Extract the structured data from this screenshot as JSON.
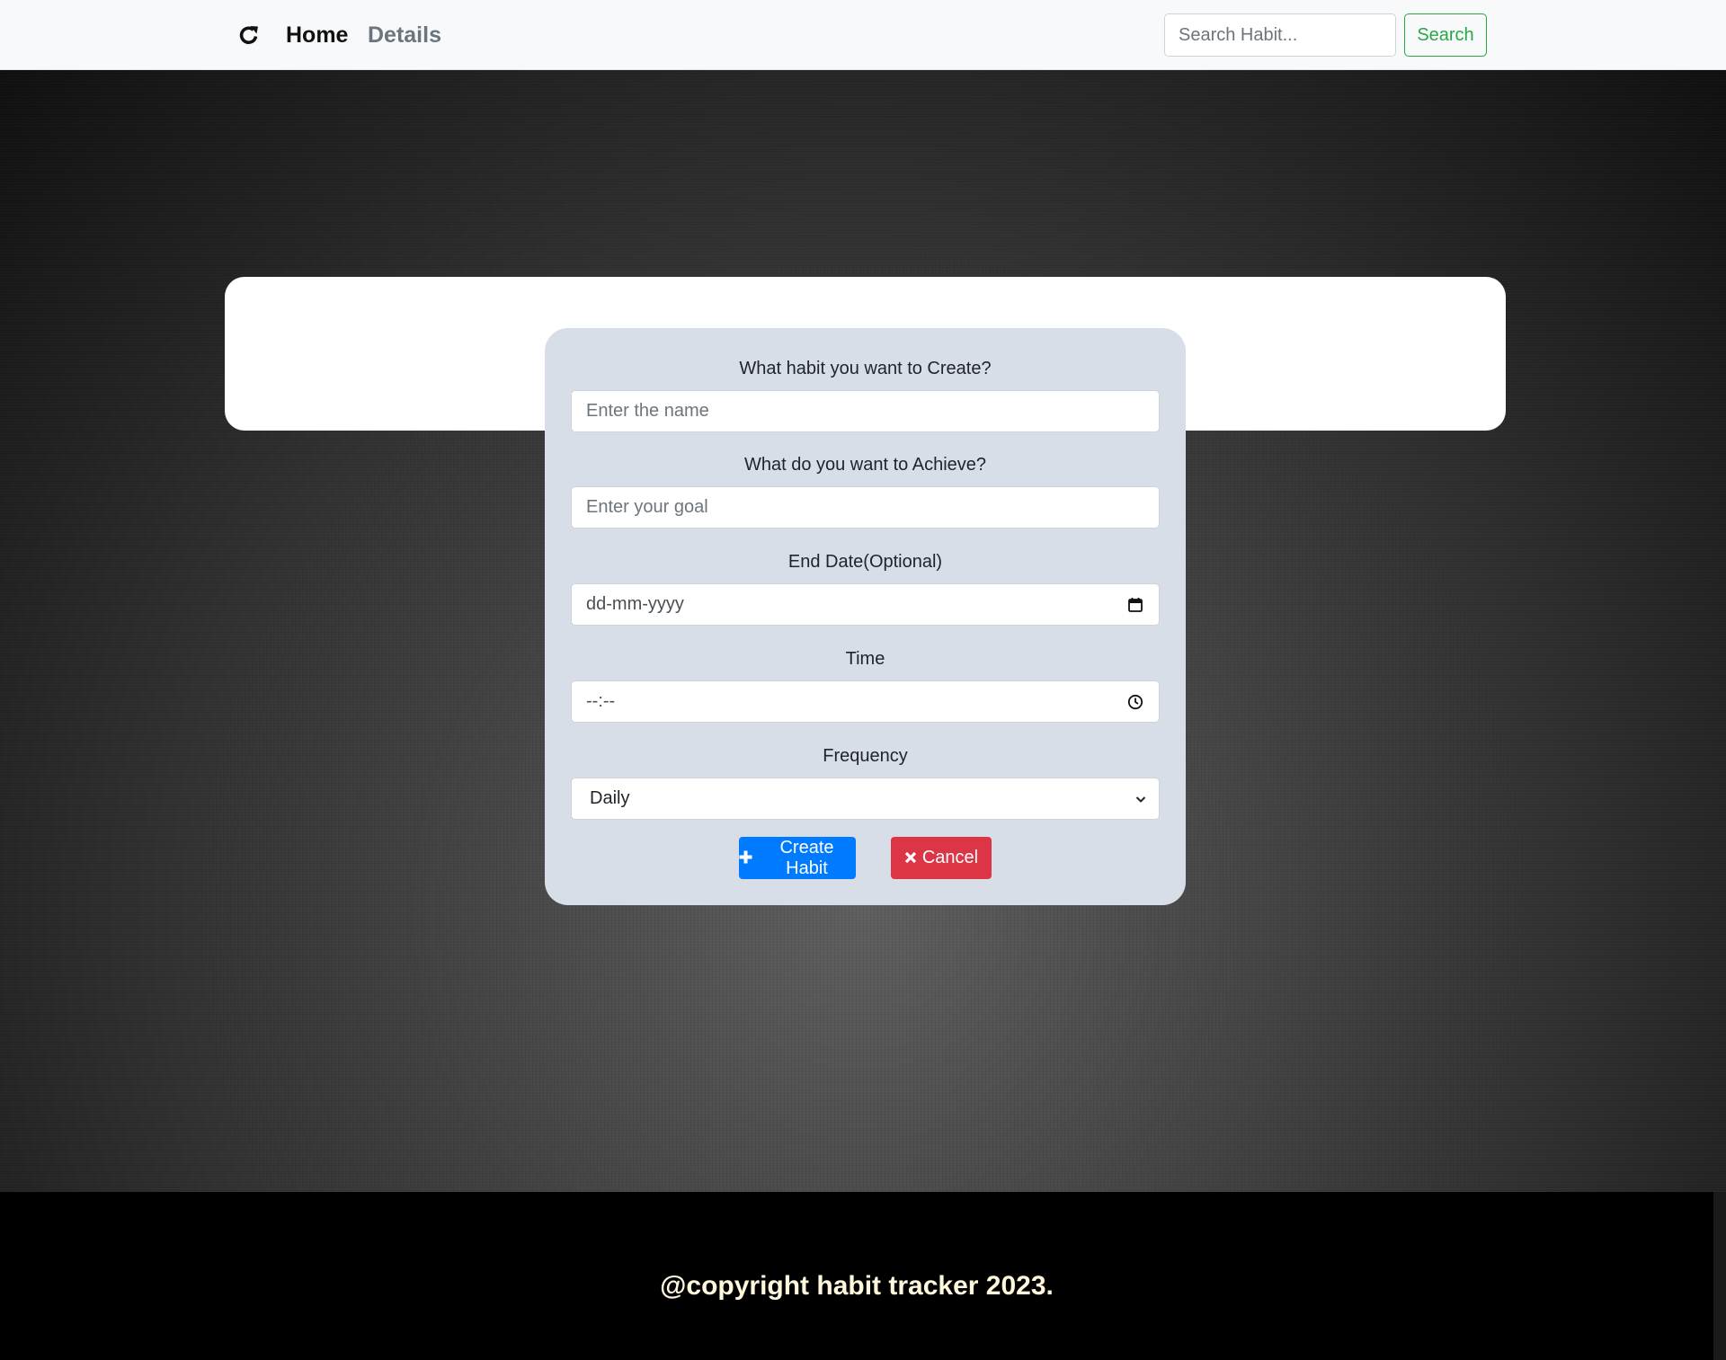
{
  "navbar": {
    "brand_icon": "refresh-icon",
    "home_label": "Home",
    "details_label": "Details",
    "search_placeholder": "Search Habit...",
    "search_button_label": "Search",
    "accent_color": "#28a745"
  },
  "form": {
    "habit_name": {
      "label": "What habit you want to Create?",
      "placeholder": "Enter the name"
    },
    "goal": {
      "label": "What do you want to Achieve?",
      "placeholder": "Enter your goal"
    },
    "end_date": {
      "label": "End Date(Optional)",
      "placeholder": "dd-mm-yyyy",
      "icon": "calendar-icon"
    },
    "time": {
      "label": "Time",
      "placeholder": "--:--",
      "icon": "clock-icon"
    },
    "frequency": {
      "label": "Frequency",
      "selected": "Daily",
      "icon": "chevron-down-icon"
    },
    "create_button": {
      "label": "Create Habit",
      "icon": "plus-icon",
      "color": "#007bff"
    },
    "cancel_button": {
      "label": "Cancel",
      "icon": "x-icon",
      "color": "#dc3545"
    }
  },
  "footer": {
    "text": "@copyright habit tracker 2023."
  }
}
